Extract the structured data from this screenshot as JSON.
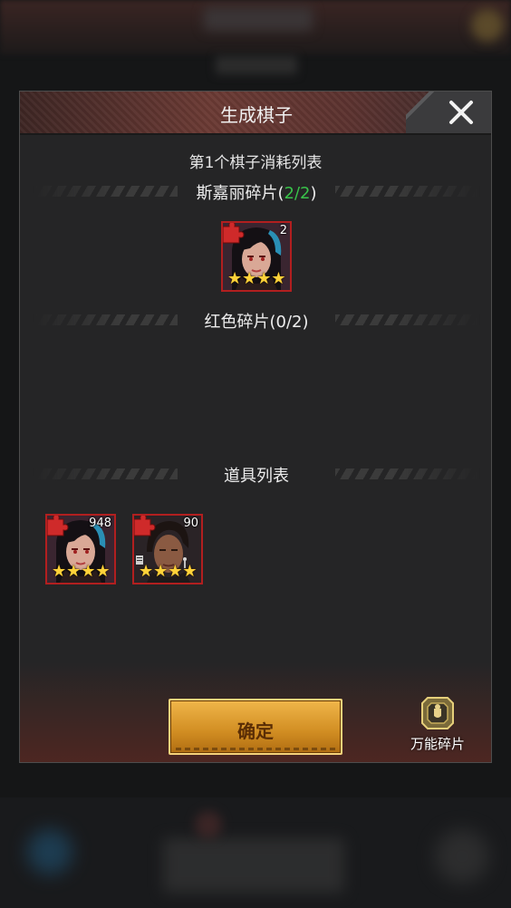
{
  "modal": {
    "title": "生成棋子",
    "subtitle": "第1个棋子消耗列表",
    "required_sections": [
      {
        "name": "斯嘉丽碎片",
        "progress_open": "(",
        "progress": "2/2",
        "progress_close": ")",
        "progress_color": "#39c24a"
      },
      {
        "name": "红色碎片(0/2)"
      }
    ],
    "required_item": {
      "count": "2",
      "stars": 4,
      "hero": "scarlett"
    },
    "item_list_title": "道具列表",
    "items": [
      {
        "count": "948",
        "stars": 4,
        "hero": "scarlett"
      },
      {
        "count": "90",
        "stars": 4,
        "hero": "earring-woman"
      }
    ],
    "confirm_label": "确定",
    "universal_label": "万能碎片"
  },
  "colors": {
    "accent_green": "#39c24a",
    "card_border": "#b21f1f",
    "confirm_gold": "#d18d22"
  },
  "icons": {
    "close": "close-icon",
    "puzzle": "puzzle-piece-icon",
    "star": "star-icon",
    "universal": "universal-shard-icon"
  }
}
